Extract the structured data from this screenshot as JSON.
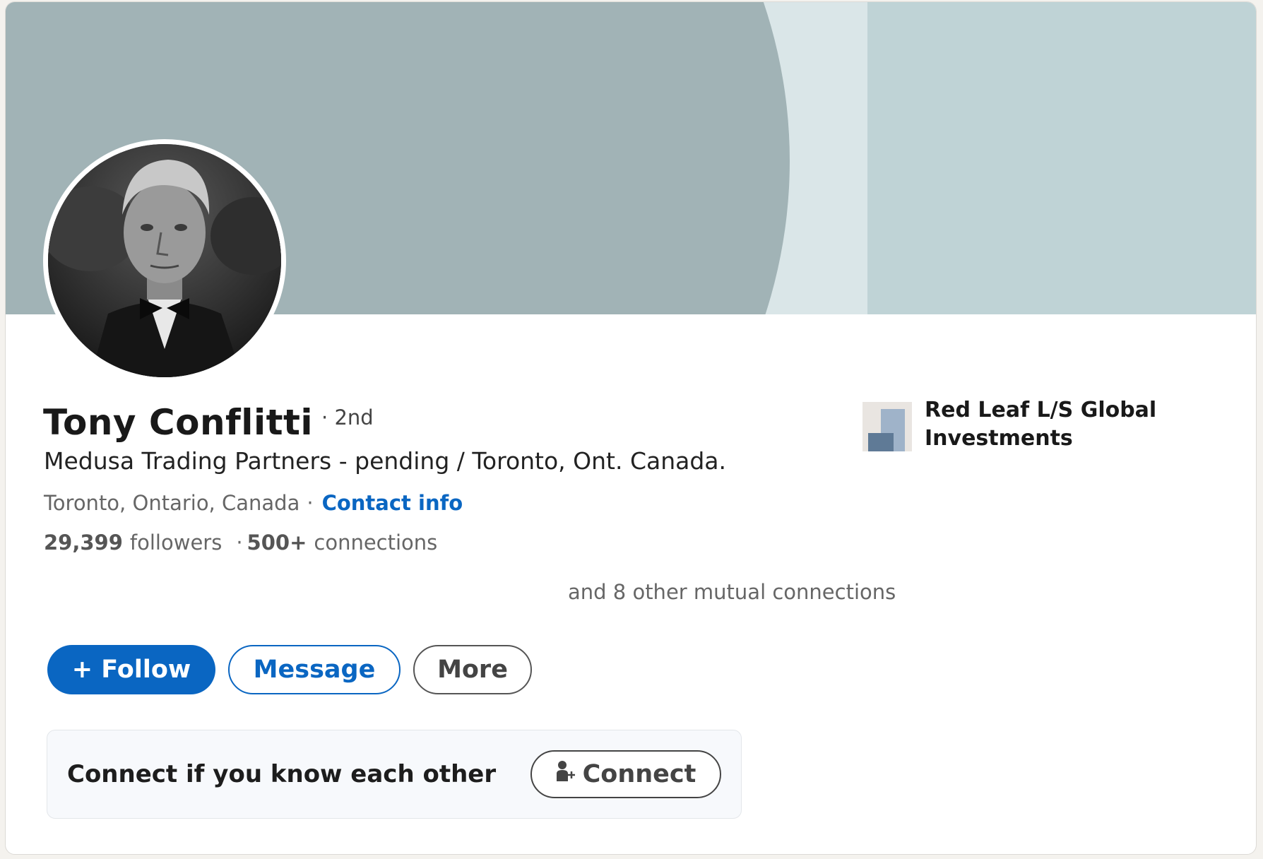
{
  "profile": {
    "name": "Tony Conflitti",
    "degree": "· 2nd",
    "headline": "Medusa Trading Partners - pending / Toronto, Ont. Canada.",
    "location": "Toronto, Ontario, Canada",
    "location_separator": "·",
    "contact_info_label": "Contact info",
    "followers_count": "29,399",
    "followers_label": "followers",
    "stats_separator": "·",
    "connections_count": "500+",
    "connections_label": "connections",
    "mutual_connections": "and 8 other mutual connections"
  },
  "company": {
    "name": "Red Leaf L/S Global Investments"
  },
  "actions": {
    "follow_label": "+ Follow",
    "message_label": "Message",
    "more_label": "More"
  },
  "connect_prompt": {
    "text": "Connect if you know each other",
    "button_label": "Connect"
  },
  "colors": {
    "accent": "#0a66c2",
    "banner_dark": "#a1b3b6",
    "banner_light": "#bfd3d6"
  },
  "icons": {
    "avatar": "profile-photo",
    "company_logo": "company-logo",
    "connect": "add-person-icon"
  }
}
